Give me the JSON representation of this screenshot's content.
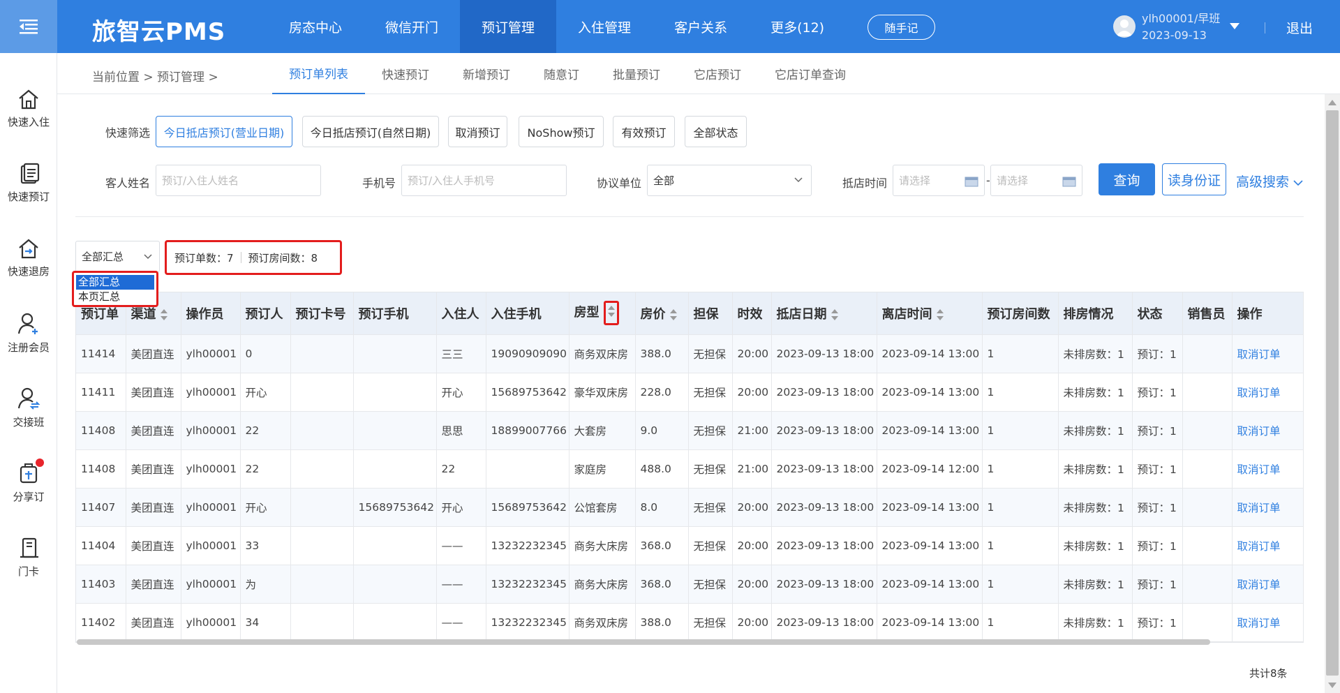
{
  "app": {
    "brand": "旅智云PMS"
  },
  "nav": [
    {
      "label": "房态中心"
    },
    {
      "label": "微信开门"
    },
    {
      "label": "预订管理"
    },
    {
      "label": "入住管理"
    },
    {
      "label": "客户关系"
    },
    {
      "label": "更多(12)"
    }
  ],
  "header": {
    "note_button": "随手记",
    "user_name": "ylh00001/早班",
    "user_date": "2023-09-13",
    "logout": "退出"
  },
  "sidebar": [
    {
      "label": "快速入住",
      "icon": "house-icon"
    },
    {
      "label": "快速预订",
      "icon": "document-icon"
    },
    {
      "label": "快速退房",
      "icon": "house-exit-icon"
    },
    {
      "label": "注册会员",
      "icon": "user-add-icon"
    },
    {
      "label": "交接班",
      "icon": "user-swap-icon"
    },
    {
      "label": "分享订",
      "icon": "share-booking-icon"
    },
    {
      "label": "门卡",
      "icon": "card-icon"
    }
  ],
  "breadcrumb": {
    "text": "当前位置 > 预订管理 >"
  },
  "subtabs": [
    {
      "label": "预订单列表"
    },
    {
      "label": "快速预订"
    },
    {
      "label": "新增预订"
    },
    {
      "label": "随意订"
    },
    {
      "label": "批量预订"
    },
    {
      "label": "它店预订"
    },
    {
      "label": "它店订单查询"
    }
  ],
  "filters": {
    "quick_label": "快速筛选",
    "chips": [
      {
        "label": "今日抵店预订(营业日期)"
      },
      {
        "label": "今日抵店预订(自然日期)"
      },
      {
        "label": "取消预订"
      },
      {
        "label": "NoShow预订"
      },
      {
        "label": "有效预订"
      },
      {
        "label": "全部状态"
      }
    ],
    "guest_label": "客人姓名",
    "guest_placeholder": "预订/入住人姓名",
    "phone_label": "手机号",
    "phone_placeholder": "预订/入住人手机号",
    "agreement_label": "协议单位",
    "agreement_value": "全部",
    "arrival_label": "抵店时间",
    "date_placeholder": "请选择",
    "date_sep": "-",
    "query_button": "查询",
    "read_id_button": "读身份证",
    "advanced_search": "高级搜索"
  },
  "summary": {
    "select_value": "全部汇总",
    "options": [
      "全部汇总",
      "本页汇总"
    ],
    "order_count": "预订单数：7",
    "room_count": "预订房间数：8"
  },
  "table": {
    "columns": [
      "预订单",
      "渠道",
      "操作员",
      "预订人",
      "预订卡号",
      "预订手机",
      "入住人",
      "入住手机",
      "房型",
      "房价",
      "担保",
      "时效",
      "抵店日期",
      "离店时间",
      "预订房间数",
      "排房情况",
      "状态",
      "销售员",
      "操作"
    ],
    "rows": [
      [
        "11414",
        "美团直连",
        "ylh00001",
        "0",
        "",
        "",
        "三三",
        "19090909090",
        "商务双床房",
        "388.0",
        "无担保",
        "20:00",
        "2023-09-13 18:00",
        "2023-09-14 13:00",
        "1",
        "未排房数：1",
        "预订：1",
        "",
        "取消订单"
      ],
      [
        "11411",
        "美团直连",
        "ylh00001",
        "开心",
        "",
        "",
        "开心",
        "15689753642",
        "豪华双床房",
        "228.0",
        "无担保",
        "20:00",
        "2023-09-13 18:00",
        "2023-09-14 13:00",
        "1",
        "未排房数：1",
        "预订：1",
        "",
        "取消订单"
      ],
      [
        "11408",
        "美团直连",
        "ylh00001",
        "22",
        "",
        "",
        "思思",
        "18899007766",
        "大套房",
        "9.0",
        "无担保",
        "21:00",
        "2023-09-13 18:00",
        "2023-09-14 13:00",
        "1",
        "未排房数：1",
        "预订：1",
        "",
        "取消订单"
      ],
      [
        "11408",
        "美团直连",
        "ylh00001",
        "22",
        "",
        "",
        "22",
        "",
        "家庭房",
        "488.0",
        "无担保",
        "21:00",
        "2023-09-13 18:00",
        "2023-09-14 12:00",
        "1",
        "未排房数：1",
        "预订：1",
        "",
        "取消订单"
      ],
      [
        "11407",
        "美团直连",
        "ylh00001",
        "开心",
        "",
        "15689753642",
        "开心",
        "15689753642",
        "公馆套房",
        "8.0",
        "无担保",
        "20:00",
        "2023-09-13 18:00",
        "2023-09-14 13:00",
        "1",
        "未排房数：1",
        "预订：1",
        "",
        "取消订单"
      ],
      [
        "11404",
        "美团直连",
        "ylh00001",
        "33",
        "",
        "",
        "——",
        "13232232345",
        "商务大床房",
        "368.0",
        "无担保",
        "20:00",
        "2023-09-13 18:00",
        "2023-09-14 13:00",
        "1",
        "未排房数：1",
        "预订：1",
        "",
        "取消订单"
      ],
      [
        "11403",
        "美团直连",
        "ylh00001",
        "为",
        "",
        "",
        "——",
        "13232232345",
        "商务大床房",
        "368.0",
        "无担保",
        "20:00",
        "2023-09-13 18:00",
        "2023-09-14 13:00",
        "1",
        "未排房数：1",
        "预订：1",
        "",
        "取消订单"
      ],
      [
        "11402",
        "美团直连",
        "ylh00001",
        "34",
        "",
        "",
        "——",
        "13232232345",
        "商务双床房",
        "388.0",
        "无担保",
        "20:00",
        "2023-09-13 18:00",
        "2023-09-14 13:00",
        "1",
        "未排房数：1",
        "预订：1",
        "",
        "取消订单"
      ]
    ],
    "total": "共计8条"
  },
  "colors": {
    "primary": "#2f7fe0",
    "highlight": "#e31d1d"
  }
}
